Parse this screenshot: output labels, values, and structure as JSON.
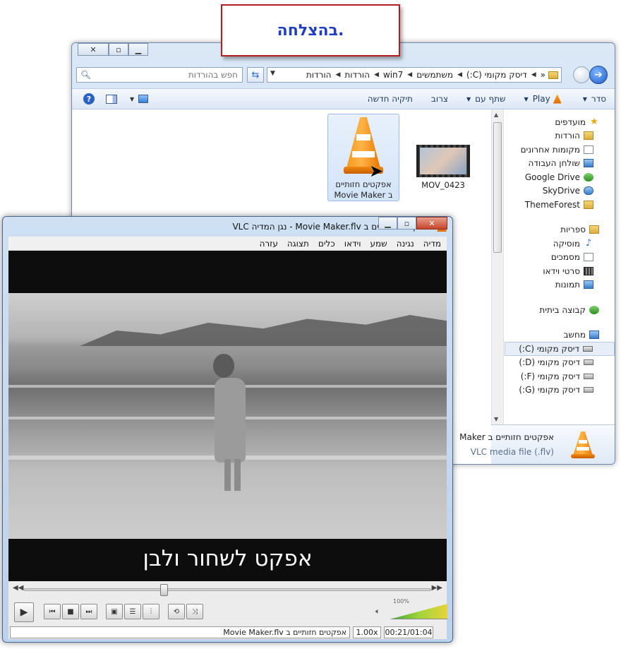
{
  "banner": {
    "text": "בהצלחה."
  },
  "explorer": {
    "window_buttons": {
      "close": "✕",
      "maximize": "▫",
      "minimize": "▁"
    },
    "search_placeholder": "חפש בהורדות",
    "breadcrumbs": [
      "«",
      "דיסק מקומי (C:)",
      "משתמשים",
      "win7",
      "הורדות",
      "הורדות"
    ],
    "toolbar": {
      "organize": "סדר",
      "play": "Play",
      "share": "שתף עם",
      "burn": "צרוב",
      "new_folder": "תיקיה חדשה"
    },
    "nav": {
      "favorites": {
        "label": "מועדפים",
        "items": [
          "הורדות",
          "מקומות אחרונים",
          "שולחן העבודה",
          "Google Drive",
          "SkyDrive",
          "ThemeForest"
        ]
      },
      "libraries": {
        "label": "ספריות",
        "items": [
          "מוסיקה",
          "מסמכים",
          "סרטי וידאו",
          "תמונות"
        ]
      },
      "homegroup": {
        "label": "קבוצה ביתית"
      },
      "computer": {
        "label": "מחשב",
        "items": [
          "דיסק מקומי (C:)",
          "דיסק מקומי (D:)",
          "דיסק מקומי (F:)",
          "דיסק מקומי (G:)"
        ]
      }
    },
    "files": [
      {
        "name_line1": "אפקטים חזותיים",
        "name_line2": "ב Movie Maker"
      },
      {
        "name_line1": "MOV_0423"
      }
    ],
    "details": {
      "name": "אפקטים חזותיים ב Maker",
      "type": "VLC media file (.flv)"
    }
  },
  "vlc": {
    "title": "אפקטים חזותיים ב Movie Maker.flv - נגן המדיה VLC",
    "menu": [
      "מדיה",
      "נגינה",
      "שמע",
      "וידאו",
      "כלים",
      "תצוגה",
      "עזרה"
    ],
    "subtitle": "אפקט לשחור ולבן",
    "volume": "100%",
    "volume_level": 1.0,
    "status_name": "אפקטים חזותיים ב Movie Maker.flv",
    "rate": "1.00x",
    "time": "00:21/01:04"
  },
  "colors": {
    "banner_border": "#b41e1e",
    "banner_text": "#1f3fbf",
    "vlc_orange": "#f39a1f"
  }
}
